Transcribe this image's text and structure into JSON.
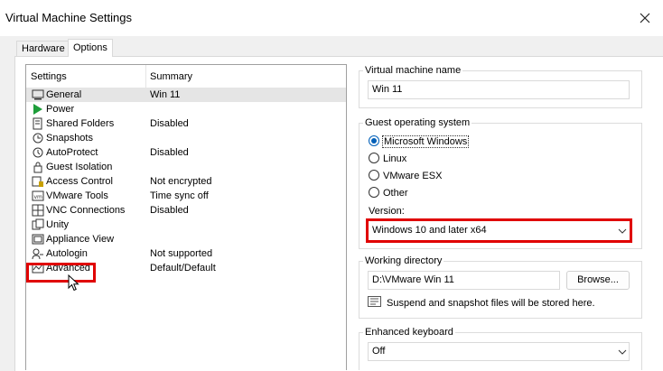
{
  "window": {
    "title": "Virtual Machine Settings"
  },
  "tabs": [
    {
      "label": "Hardware"
    },
    {
      "label": "Options"
    }
  ],
  "settings_list": {
    "col_settings": "Settings",
    "col_summary": "Summary",
    "rows": [
      {
        "label": "General",
        "summary": "Win 11",
        "icon": "monitor-icon"
      },
      {
        "label": "Power",
        "summary": "",
        "icon": "play-icon"
      },
      {
        "label": "Shared Folders",
        "summary": "Disabled",
        "icon": "shared-folder-icon"
      },
      {
        "label": "Snapshots",
        "summary": "",
        "icon": "snapshot-icon"
      },
      {
        "label": "AutoProtect",
        "summary": "Disabled",
        "icon": "clock-shield-icon"
      },
      {
        "label": "Guest Isolation",
        "summary": "",
        "icon": "lock-icon"
      },
      {
        "label": "Access Control",
        "summary": "Not encrypted",
        "icon": "access-control-icon"
      },
      {
        "label": "VMware Tools",
        "summary": "Time sync off",
        "icon": "vmware-tools-icon"
      },
      {
        "label": "VNC Connections",
        "summary": "Disabled",
        "icon": "vnc-icon"
      },
      {
        "label": "Unity",
        "summary": "",
        "icon": "unity-icon"
      },
      {
        "label": "Appliance View",
        "summary": "",
        "icon": "appliance-view-icon"
      },
      {
        "label": "Autologin",
        "summary": "Not supported",
        "icon": "autologin-icon"
      },
      {
        "label": "Advanced",
        "summary": "Default/Default",
        "icon": "advanced-chart-icon"
      }
    ]
  },
  "vm_name": {
    "label": "Virtual machine name",
    "value": "Win 11"
  },
  "guest_os": {
    "label": "Guest operating system",
    "options": [
      "Microsoft Windows",
      "Linux",
      "VMware ESX",
      "Other"
    ],
    "selected": "Microsoft Windows",
    "version_label": "Version:",
    "version_value": "Windows 10 and later x64"
  },
  "working_dir": {
    "label": "Working directory",
    "value": "D:\\VMware Win 11",
    "browse_label": "Browse...",
    "info": "Suspend and snapshot files will be stored here."
  },
  "keyboard": {
    "label": "Enhanced keyboard",
    "value": "Off"
  },
  "colors": {
    "highlight": "#e00000",
    "accent": "#005fb8"
  }
}
